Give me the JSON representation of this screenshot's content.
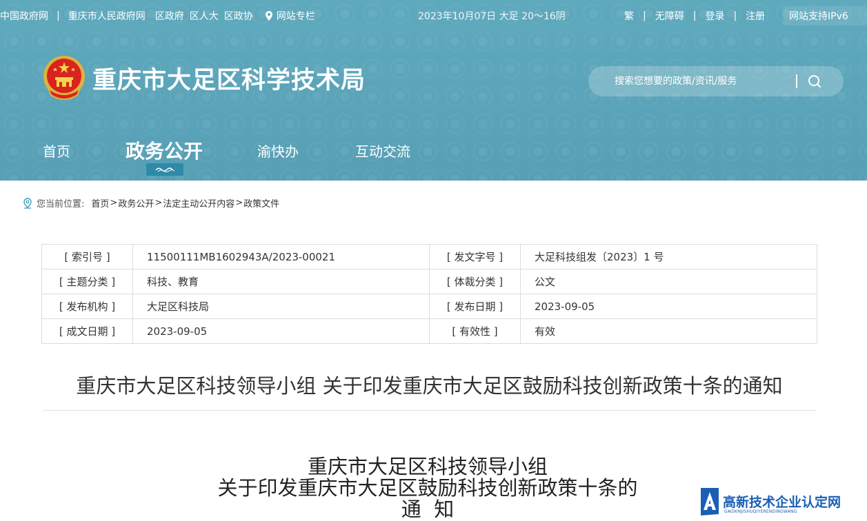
{
  "topbar": {
    "links": [
      "中国政府网",
      "重庆市人民政府网",
      "区政府",
      "区人大",
      "区政协"
    ],
    "special_column": "网站专栏",
    "date_weather": "2023年10月07日 大足 20～16阴",
    "right_links": [
      "繁",
      "无障碍",
      "登录",
      "注册"
    ],
    "ipv6": "网站支持IPv6"
  },
  "site": {
    "title": "重庆市大足区科学技术局"
  },
  "search": {
    "placeholder": "搜索您想要的政策/资讯/服务"
  },
  "nav": {
    "items": [
      "首页",
      "政务公开",
      "渝快办",
      "互动交流"
    ],
    "active": "政务公开"
  },
  "breadcrumb": {
    "label": "您当前位置:",
    "items": [
      "首页",
      "政务公开",
      "法定主动公开内容",
      "政策文件"
    ],
    "separator": ">"
  },
  "info_table": [
    {
      "k1": "[ 索引号 ]",
      "v1": "11500111MB1602943A/2023-00021",
      "k2": "[ 发文字号 ]",
      "v2": "大足科技组发〔2023〕1 号"
    },
    {
      "k1": "[ 主题分类 ]",
      "v1": "科技、教育",
      "k2": "[ 体裁分类 ]",
      "v2": "公文"
    },
    {
      "k1": "[ 发布机构 ]",
      "v1": "大足区科技局",
      "k2": "[ 发布日期 ]",
      "v2": "2023-09-05"
    },
    {
      "k1": "[ 成文日期 ]",
      "v1": "2023-09-05",
      "k2": "[ 有效性 ]",
      "v2": "有效"
    }
  ],
  "document": {
    "title": "重庆市大足区科技领导小组 关于印发重庆市大足区鼓励科技创新政策十条的通知",
    "body_title_lines": [
      "重庆市大足区科技领导小组",
      "关于印发重庆市大足区鼓励科技创新政策十条的",
      "通  知"
    ]
  },
  "watermark": {
    "text": "高新技术企业认定网",
    "sub": "GAOXINJISHUQIYERENDINGWANG"
  },
  "colors": {
    "header_bg": "#5aa3b8",
    "nav_active_bar": "#2e8aa6",
    "watermark": "#1a5fb4"
  }
}
